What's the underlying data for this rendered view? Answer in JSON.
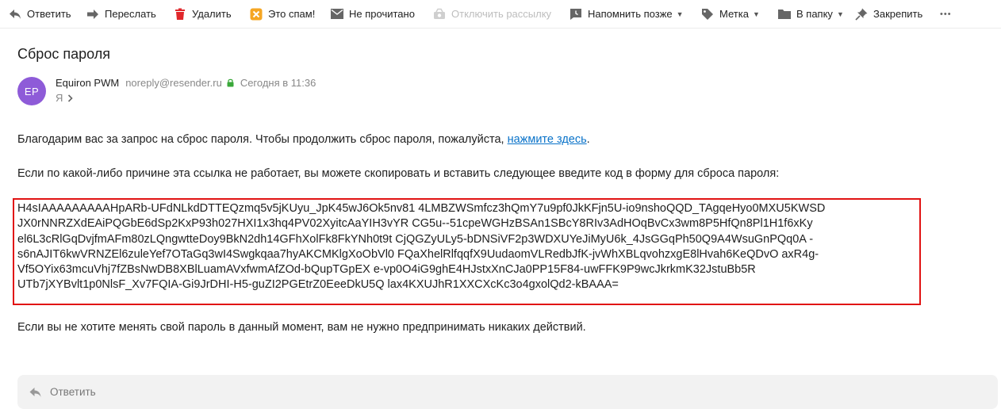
{
  "toolbar": {
    "reply": "Ответить",
    "forward": "Переслать",
    "delete": "Удалить",
    "spam": "Это спам!",
    "unread": "Не прочитано",
    "unsubscribe": "Отключить рассылку",
    "remind": "Напомнить позже",
    "label": "Метка",
    "folder": "В папку",
    "pin": "Закрепить",
    "more": "•••"
  },
  "message": {
    "subject": "Сброс пароля",
    "avatar_initials": "EP",
    "avatar_color": "#8e5bd8",
    "sender_name": "Equiron PWM",
    "sender_email": "noreply@resender.ru",
    "date": "Сегодня в 11:36",
    "recipient": "Я"
  },
  "body": {
    "para1_text": "Благодарим вас за запрос на сброс пароля. Чтобы продолжить сброс пароля, пожалуйста, ",
    "para1_link": "нажмите здесь",
    "para1_end": ".",
    "para2": "Если по какой-либо причине эта ссылка не работает, вы можете скопировать и вставить следующее введите код в форму для сброса пароля:",
    "code_lines": [
      "H4sIAAAAAAAAAHpARb-UFdNLkdDTTEQzmq5v5jKUyu_JpK45wJ6Ok5nv81 4LMBZWSmfcz3hQmY7u9pf0JkKFjn5U-io9nshoQQD_TAgqeHyo0MXU5KWSD",
      "JX0rNNRZXdEAiPQGbE6dSp2KxP93h027HXI1x3hq4PV02XyitcAaYIH3vYR CG5u--51cpeWGHzBSAn1SBcY8RIv3AdHOqBvCx3wm8P5HfQn8Pl1H1f6xKy",
      "el6L3cRlGqDvjfmAFm80zLQngwtteDoy9BkN2dh14GFhXolFk8FkYNh0t9t CjQGZyULy5-bDNSiVF2p3WDXUYeJiMyU6k_4JsGGqPh50Q9A4WsuGnPQq0A -",
      "s6nAJIT6kwVRNZEl6zuleYef7OTaGq3wI4Swgkqaa7hyAKCMKlgXoObVl0 FQaXhelRlfqqfX9UudaomVLRedbJfK-jvWhXBLqvohzxgE8lHvah6KeQDvO axR4g-",
      "Vf5OYix63mcuVhj7fZBsNwDB8XBlLuamAVxfwmAfZOd-bQupTGpEX e-vp0O4iG9ghE4HJstxXnCJa0PP15F84-uwFFK9P9wcJkrkmK32JstuBb5R",
      "UTb7jXYBvlt1p0NlsF_Xv7FQIA-Gi9JrDHI-H5-guZI2PGEtrZ0EeeDkU5Q lax4KXUJhR1XXCXcKc3o4gxolQd2-kBAAA="
    ],
    "para3": "Если вы не хотите менять свой пароль в данный момент, вам не нужно предпринимать никаких действий."
  },
  "reply_bar": {
    "label": "Ответить"
  }
}
